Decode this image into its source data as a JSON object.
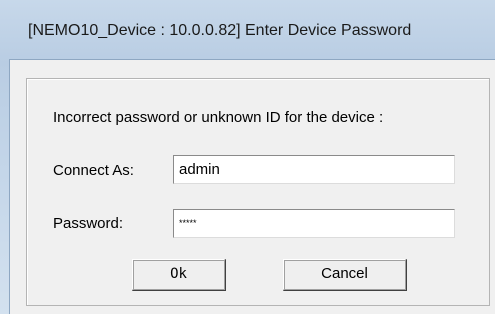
{
  "window": {
    "title": "[NEMO10_Device : 10.0.0.82] Enter Device Password"
  },
  "dialog": {
    "message": "Incorrect password or unknown ID for the device :",
    "connect_as_label": "Connect As:",
    "connect_as_value": "admin",
    "password_label": "Password:",
    "password_value": "*****",
    "ok_label": "Ok",
    "cancel_label": "Cancel"
  }
}
